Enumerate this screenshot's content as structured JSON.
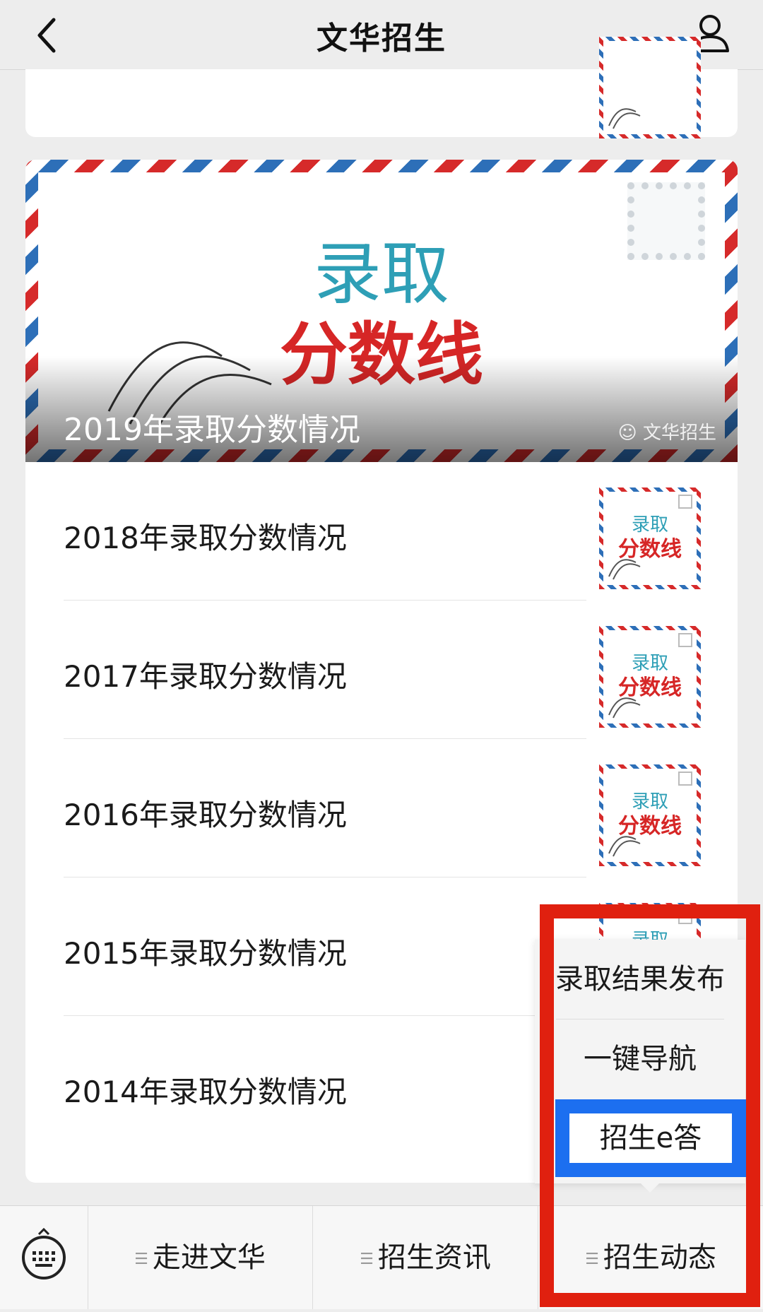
{
  "header": {
    "title": "文华招生",
    "back_icon": "chevron-left-icon",
    "user_icon": "user-icon"
  },
  "thumb": {
    "line1": "录取",
    "line2": "分数线"
  },
  "banner": {
    "line1": "录取",
    "line2": "分数线",
    "caption": "2019年录取分数情况",
    "watermark": "文华招生"
  },
  "articles": [
    {
      "title": "2018年录取分数情况"
    },
    {
      "title": "2017年录取分数情况"
    },
    {
      "title": "2016年录取分数情况"
    },
    {
      "title": "2015年录取分数情况"
    },
    {
      "title": "2014年录取分数情况"
    }
  ],
  "popup": {
    "items": [
      "录取结果发布",
      "一键导航",
      "招生e答"
    ]
  },
  "bottom_menu": {
    "keyboard_icon": "keyboard-icon",
    "items": [
      "走进文华",
      "招生资讯",
      "招生动态"
    ]
  },
  "colors": {
    "highlight_red": "#e0200f",
    "highlight_blue": "#1c6ff0",
    "teal": "#2e9fb6",
    "red": "#d62626"
  }
}
